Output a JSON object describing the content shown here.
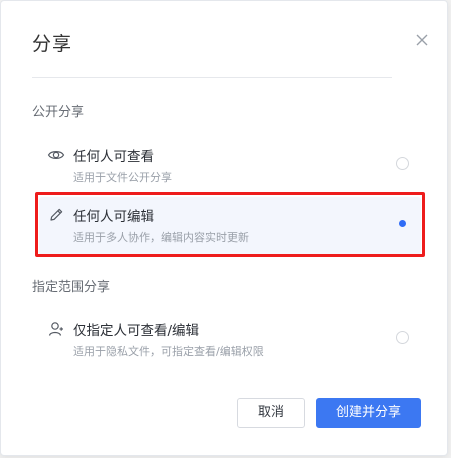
{
  "dialog": {
    "title": "分享",
    "close_icon": "close-icon"
  },
  "public_section": {
    "label": "公开分享",
    "options": [
      {
        "icon": "eye-icon",
        "title": "任何人可查看",
        "desc": "适用于文件公开分享",
        "selected": false
      },
      {
        "icon": "pencil-icon",
        "title": "任何人可编辑",
        "desc": "适用于多人协作，编辑内容实时更新",
        "selected": true
      }
    ]
  },
  "scoped_section": {
    "label": "指定范围分享",
    "options": [
      {
        "icon": "user-icon",
        "title": "仅指定人可查看/编辑",
        "desc": "适用于隐私文件，可指定查看/编辑权限",
        "selected": false
      }
    ]
  },
  "footer": {
    "cancel_label": "取消",
    "confirm_label": "创建并分享"
  },
  "colors": {
    "accent": "#3c78f2",
    "highlight_border": "#ee1c1c",
    "selected_bg": "#f3f6fd"
  }
}
